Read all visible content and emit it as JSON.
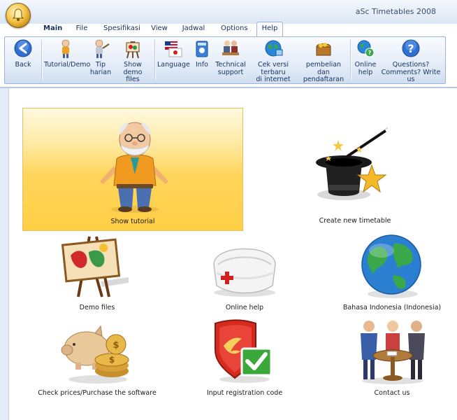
{
  "window": {
    "title": "aSc Timetables 2008"
  },
  "tabs": [
    {
      "label": "Main"
    },
    {
      "label": "File"
    },
    {
      "label": "Spesifikasi"
    },
    {
      "label": "View"
    },
    {
      "label": "Jadwal"
    },
    {
      "label": "Options"
    },
    {
      "label": "Help"
    }
  ],
  "ribbon": {
    "back": "Back",
    "tutorial": "Tutorial/Demo",
    "tip_l1": "Tip",
    "tip_l2": "harian",
    "demo_l1": "Show demo",
    "demo_l2": "files",
    "language": "Language",
    "info": "Info",
    "tech_l1": "Technical",
    "tech_l2": "support",
    "cek_l1": "Cek versi terbaru",
    "cek_l2": "di internet",
    "buy_l1": "pembelian dan",
    "buy_l2": "pendaftaran",
    "online_l1": "Online",
    "online_l2": "help",
    "q_l1": "Questions?",
    "q_l2": "Comments? Write us"
  },
  "tiles": {
    "show_tutorial": "Show tutorial",
    "create_timetable": "Create new timetable",
    "demo_files": "Demo files",
    "online_help": "Online help",
    "language": "Bahasa Indonesia (Indonesia)",
    "check_prices": "Check prices/Purchase the software",
    "registration": "Input registration code",
    "contact": "Contact us"
  },
  "colors": {
    "accent": "#2f6fd1",
    "highlight": "#ffd45a"
  }
}
